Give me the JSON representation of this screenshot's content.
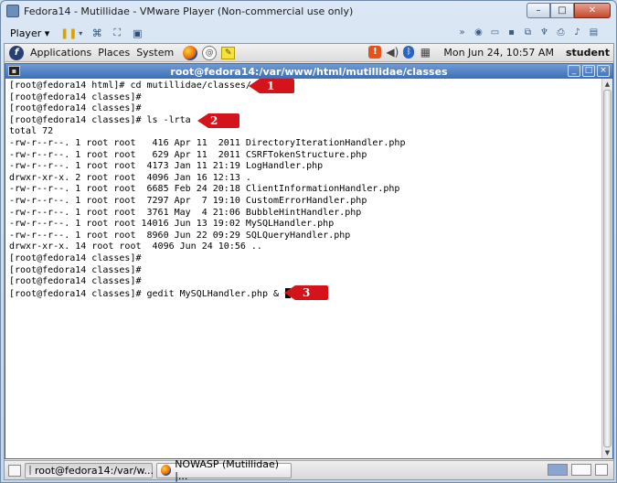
{
  "vm": {
    "title": "Fedora14 - Mutillidae - VMware Player (Non-commercial use only)",
    "player_menu": "Player",
    "caption_min": "–",
    "caption_max": "□",
    "caption_close": "✕",
    "toolbar_icons": [
      "pause-icon",
      "send-ctrl-alt-del-icon",
      "fullscreen-icon",
      "unity-icon"
    ],
    "device_icons": [
      "chevron-right-icon",
      "cdrom-icon",
      "hard-disk-icon",
      "floppy-icon",
      "network-icon",
      "usb-icon",
      "printer-icon",
      "sound-icon",
      "display-icon"
    ]
  },
  "gnome": {
    "menus": [
      "Applications",
      "Places",
      "System"
    ],
    "clock": "Mon Jun 24, 10:57 AM",
    "user": "student"
  },
  "terminal": {
    "title": "root@fedora14:/var/www/html/mutillidae/classes",
    "lines": [
      "[root@fedora14 html]# cd mutillidae/classes/",
      "[root@fedora14 classes]#",
      "[root@fedora14 classes]#",
      "[root@fedora14 classes]# ls -lrta",
      "total 72",
      "-rw-r--r--. 1 root root   416 Apr 11  2011 DirectoryIterationHandler.php",
      "-rw-r--r--. 1 root root   629 Apr 11  2011 CSRFTokenStructure.php",
      "-rw-r--r--. 1 root root  4173 Jan 11 21:19 LogHandler.php",
      "drwxr-xr-x. 2 root root  4096 Jan 16 12:13 .",
      "-rw-r--r--. 1 root root  6685 Feb 24 20:18 ClientInformationHandler.php",
      "-rw-r--r--. 1 root root  7297 Apr  7 19:10 CustomErrorHandler.php",
      "-rw-r--r--. 1 root root  3761 May  4 21:06 BubbleHintHandler.php",
      "-rw-r--r--. 1 root root 14016 Jun 13 19:02 MySQLHandler.php",
      "-rw-r--r--. 1 root root  8960 Jun 22 09:29 SQLQueryHandler.php",
      "drwxr-xr-x. 14 root root  4096 Jun 24 10:56 ..",
      "[root@fedora14 classes]#",
      "[root@fedora14 classes]#",
      "[root@fedora14 classes]#"
    ],
    "current_line": "[root@fedora14 classes]# gedit MySQLHandler.php &"
  },
  "annotations": [
    "1",
    "2",
    "3"
  ],
  "taskbar": {
    "items": [
      {
        "label": "root@fedora14:/var/w...",
        "icon": "terminal-icon"
      },
      {
        "label": "NOWASP (Mutillidae) |...",
        "icon": "firefox-icon"
      }
    ]
  },
  "colors": {
    "annotation_red": "#d4141a",
    "terminal_titlebar": "#3d6fb5"
  }
}
